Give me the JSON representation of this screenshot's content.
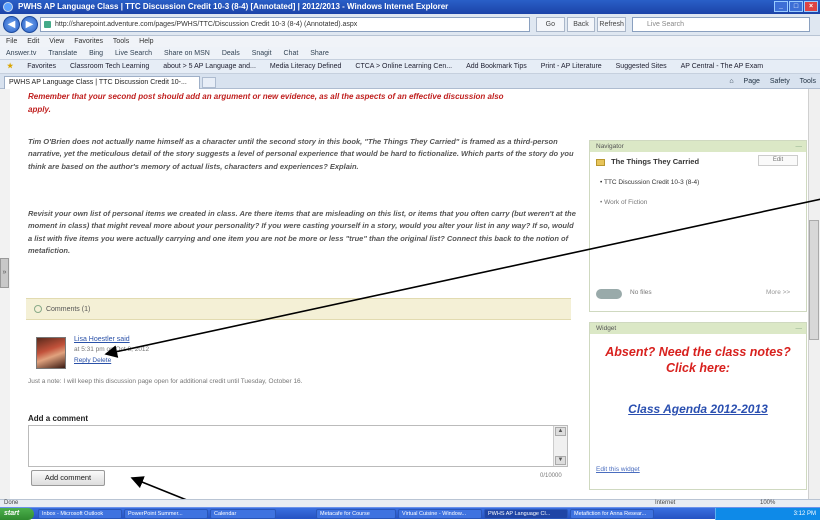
{
  "window": {
    "title": "PWHS AP Language Class | TTC Discussion Credit 10-3 (8-4) [Annotated] | 2012/2013 - Windows Internet Explorer"
  },
  "address": {
    "url": "http://sharepoint.adventure.com/pages/PWHS/TTC/Discussion Credit 10-3 (8-4) (Annotated).aspx",
    "buttons": [
      "Go",
      "Back",
      "Refresh"
    ],
    "search_placeholder": "Live Search"
  },
  "menu": [
    "File",
    "Edit",
    "View",
    "Favorites",
    "Tools",
    "Help"
  ],
  "commandbar": [
    "Answer.tv",
    "Translate",
    "Bing",
    "Live Search",
    "Share on MSN",
    "Deals",
    "Snagit",
    "Chat",
    "Share"
  ],
  "favorites": {
    "label": "Favorites",
    "items": [
      "Classroom Tech Learning",
      "about > 5 AP Language and...",
      "Media Literacy Defined",
      "CTCA > Online Learning Cen...",
      "Add Bookmark Tips",
      "Print - AP Literature",
      "Suggested Sites",
      "AP Central - The AP Exam"
    ]
  },
  "tab": {
    "title": "PWHS AP Language Class | TTC Discussion Credit 10-..."
  },
  "pagetools": [
    "Page",
    "Safety",
    "Tools"
  ],
  "content": {
    "redline": "Remember that your second post should add an argument or new evidence, as all the aspects of an effective discussion also",
    "apply": "apply.",
    "q1": "Tim O'Brien does not actually name himself as a character until the second story in this book, \"The Things They Carried\" is framed as a third-person narrative, yet the meticulous detail of the story suggests a level of personal experience that would be hard to fictionalize. Which parts of the story do you think are based on the author's memory of actual lists, characters and experiences? Explain.",
    "q2": "Revisit your own list of personal items we created in class. Are there items that are misleading on this list, or items that you often carry (but weren't at the moment in class) that might reveal more about your personality? If you were casting yourself in a story, would you alter your list in any way? If so, would a list with five items you were actually carrying and one item you are not be more or less \"true\" than the original list? Connect this back to the notion of metafiction.",
    "comments_label": "Comments (1)",
    "comment": {
      "author": "Lisa Hoestler said",
      "date": "at 5:31 pm on Oct 8, 2012",
      "reply": "Reply  Delete",
      "text": "Just a note: I will keep this discussion page open for additional credit until Tuesday, October 16."
    },
    "add_comment_title": "Add a comment",
    "add_comment_button": "Add comment",
    "char_count": "0/10000"
  },
  "sidebar": {
    "navigator": {
      "title": "Navigator",
      "folder": "The Things They Carried",
      "edit": "Edit",
      "items": [
        "TTC Discussion Credit 10-3 (8-4)",
        "Work of Fiction"
      ],
      "toggle_label": "No files",
      "more": "More >>"
    },
    "widget": {
      "title": "Widget",
      "absent": "Absent? Need the class notes? Click here:",
      "agenda": "Class Agenda 2012-2013",
      "edit": "Edit this widget"
    }
  },
  "statusbar": {
    "text": "Done",
    "zone": "Internet",
    "zoom": "100%"
  },
  "taskbar": {
    "start": "start",
    "items": [
      "Inbox - Microsoft Outlook",
      "PowerPoint Summer...",
      "Calendar",
      "Metacafe for Course",
      "Virtual Cuisine - Window...",
      "PWHS AP Language Cl...",
      "Metafiction for Anna Resear..."
    ],
    "clock": "3:12 PM"
  },
  "colors": {
    "accent_red": "#d8211e",
    "link_blue": "#2a4fb0",
    "panel_green": "#dbe8c6",
    "comments_bg": "#f4f0d6"
  }
}
